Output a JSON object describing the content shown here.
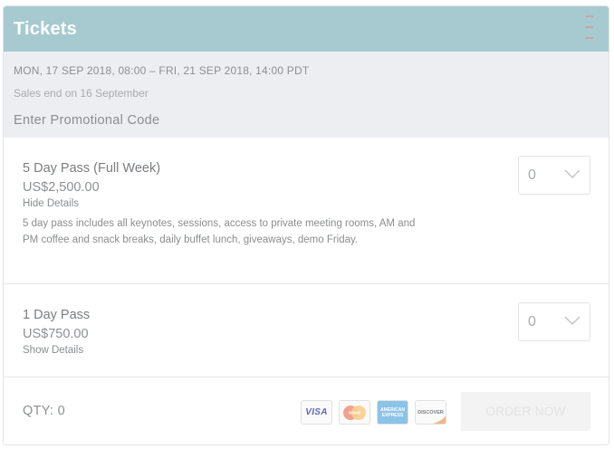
{
  "header": {
    "title": "Tickets"
  },
  "event": {
    "dates": "MON, 17 SEP 2018, 08:00 – FRI, 21 SEP 2018, 14:00 PDT",
    "sales_end": "Sales end on 16 September",
    "promo_label": "Enter Promotional Code"
  },
  "tickets": [
    {
      "name": "5 Day Pass (Full Week)",
      "price": "US$2,500.00",
      "details_toggle": "Hide Details",
      "description": "5 day pass includes all keynotes, sessions, access to private meeting rooms, AM and PM coffee and snack breaks, daily buffet lunch, giveaways, demo Friday.",
      "quantity": "0"
    },
    {
      "name": "1 Day Pass",
      "price": "US$750.00",
      "details_toggle": "Show Details",
      "quantity": "0"
    }
  ],
  "footer": {
    "qty_label": "QTY: 0",
    "cards": {
      "visa": "VISA",
      "amex": "AMERICAN EXPRESS",
      "discover": "DISCOVER"
    },
    "order_button": "ORDER NOW"
  },
  "colors": {
    "header_bg": "#a7cad0",
    "info_bg": "#eceef1",
    "button_bg": "#f3f3f4"
  },
  "icons": [
    "close-icon",
    "chevron-down-icon",
    "visa-icon",
    "mastercard-icon",
    "amex-icon",
    "discover-icon"
  ]
}
